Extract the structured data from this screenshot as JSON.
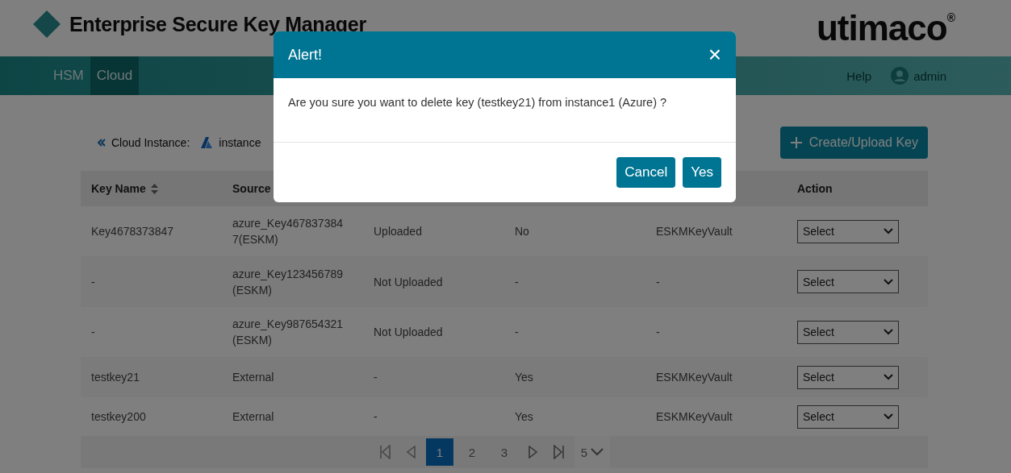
{
  "header": {
    "title": "Enterprise Secure Key Manager",
    "logo": "utimaco",
    "logo_mark": "®"
  },
  "nav": {
    "tabs": [
      {
        "label": "HSM",
        "selected": false
      },
      {
        "label": "Cloud",
        "selected": true
      }
    ],
    "help": "Help",
    "user": "admin"
  },
  "breadcrumb": {
    "label": "Cloud Instance:",
    "instance": "instance"
  },
  "create_button": {
    "label": "Create/Upload Key"
  },
  "table": {
    "headers": {
      "key_name": "Key Name",
      "source": "Source",
      "action": "Action"
    },
    "rows": [
      {
        "key_name": "Key4678373847",
        "source": "azure_Key4678373847(ESKM)",
        "status": "Uploaded",
        "column_4": "No",
        "column_5": "ESKMKeyVault",
        "action": "Select"
      },
      {
        "key_name": "-",
        "source": "azure_Key123456789 (ESKM)",
        "status": "Not Uploaded",
        "column_4": "-",
        "column_5": "-",
        "action": "Select"
      },
      {
        "key_name": "-",
        "source": "azure_Key987654321 (ESKM)",
        "status": "Not Uploaded",
        "column_4": "-",
        "column_5": "-",
        "action": "Select"
      },
      {
        "key_name": "testkey21",
        "source": "External",
        "status": "-",
        "column_4": "Yes",
        "column_5": "ESKMKeyVault",
        "action": "Select"
      },
      {
        "key_name": "testkey200",
        "source": "External",
        "status": "-",
        "column_4": "Yes",
        "column_5": "ESKMKeyVault",
        "action": "Select"
      }
    ]
  },
  "pagination": {
    "pages": [
      {
        "label": "1",
        "selected": true
      },
      {
        "label": "2",
        "selected": false
      },
      {
        "label": "3",
        "selected": false
      }
    ],
    "page_size": "5"
  },
  "dialog": {
    "title": "Alert!",
    "close": "×",
    "message": "Are you sure you want to delete key (testkey21) from instance1 (Azure) ?",
    "buttons": [
      "Cancel",
      "Yes"
    ]
  }
}
